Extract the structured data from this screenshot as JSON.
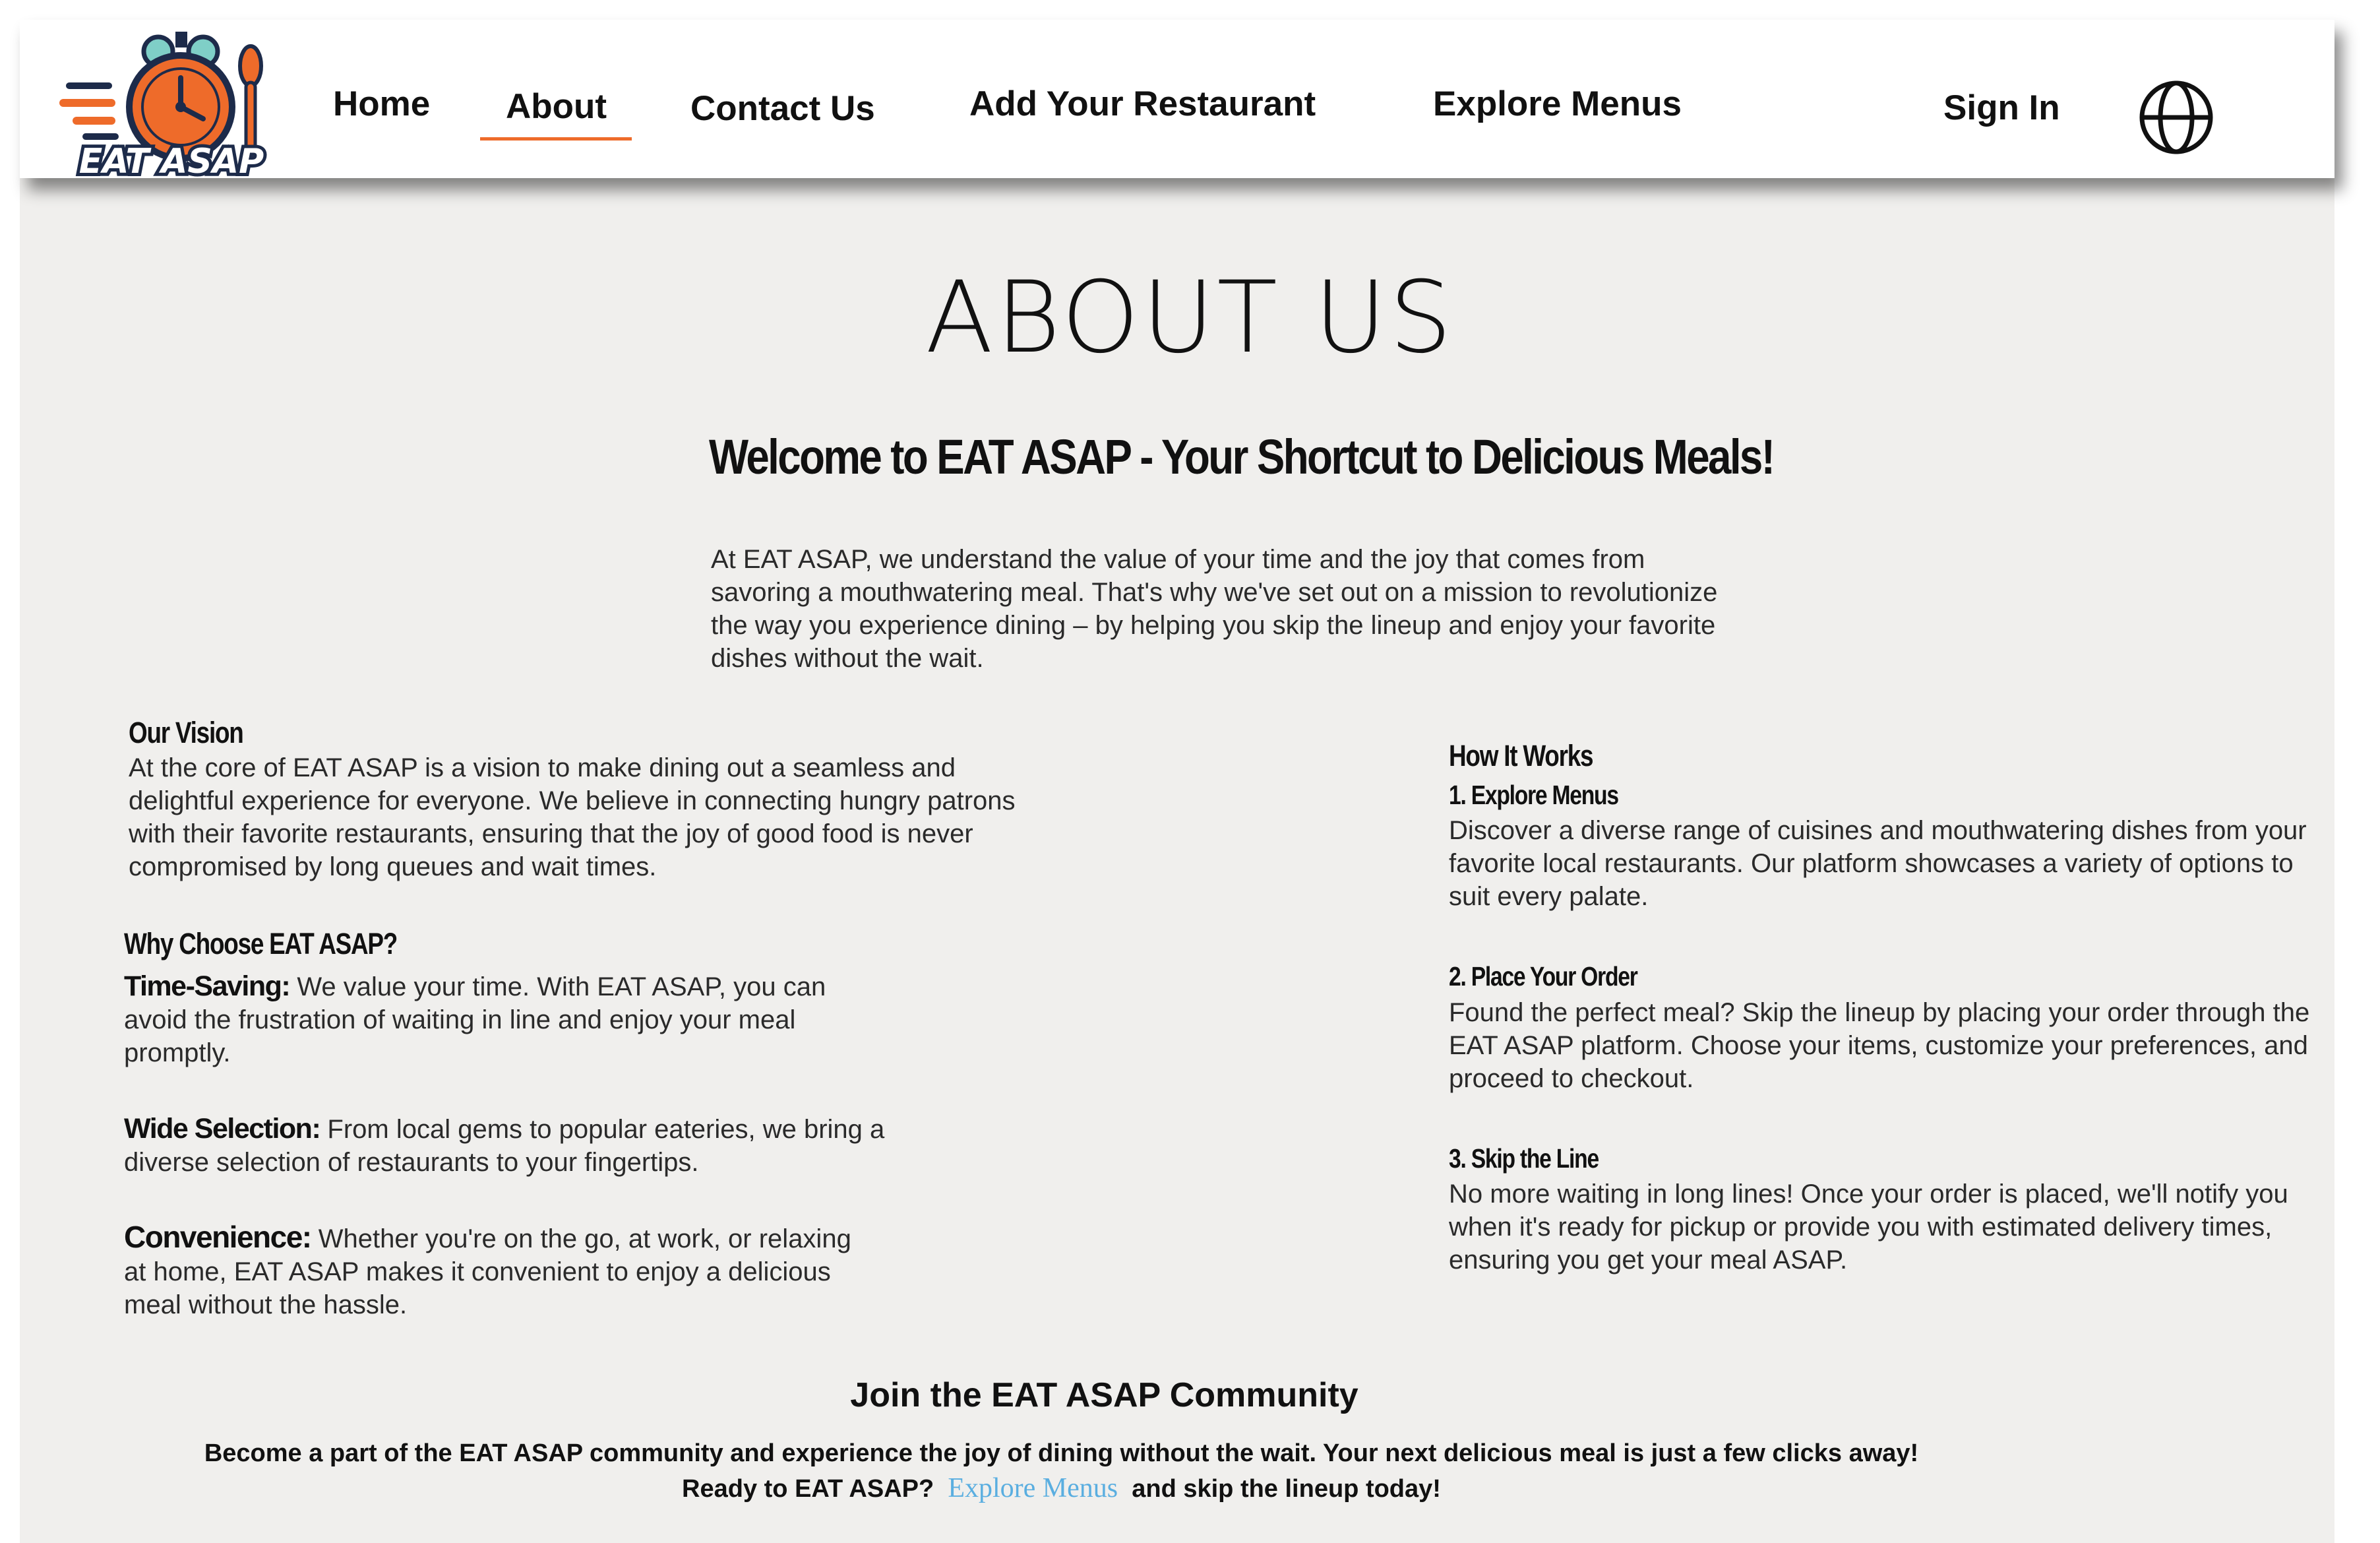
{
  "brand": {
    "logo_text": "EAT ASAP",
    "colors": {
      "orange": "#ee6b2a",
      "navy": "#1d2b4a",
      "teal": "#7fcfc7"
    }
  },
  "nav": {
    "home": "Home",
    "about": "About",
    "contact": "Contact Us",
    "add_restaurant": "Add Your Restaurant",
    "explore": "Explore Menus",
    "sign_in": "Sign In",
    "active_item": "About",
    "active_color": "#ee6b2a",
    "language_icon": "globe-icon"
  },
  "main": {
    "title": "ABOUT US",
    "welcome_heading": "Welcome to EAT ASAP - Your Shortcut to Delicious Meals!",
    "intro_lines": [
      "At EAT ASAP, we understand the value of your time and the joy that comes from",
      "savoring a mouthwatering meal. That's why we've set out on a mission to revolutionize",
      "the way you experience dining – by helping you skip the lineup and enjoy your favorite",
      "dishes without the wait."
    ],
    "vision": {
      "heading": "Our Vision",
      "lines": [
        "At the core of EAT ASAP is a vision to make dining out a seamless and",
        "delightful experience for everyone. We believe in connecting hungry patrons",
        "with their favorite restaurants, ensuring that the joy of good food is never",
        "compromised by long queues and wait times."
      ]
    },
    "why": {
      "heading": "Why Choose EAT ASAP?",
      "time_saving": {
        "term": "Time-Saving:",
        "lines": [
          "We value your time. With EAT ASAP, you can",
          "avoid the frustration of waiting in line and enjoy your meal",
          "promptly."
        ]
      },
      "wide_selection": {
        "term": "Wide Selection:",
        "lines": [
          "From local gems to popular eateries, we bring a",
          "diverse selection of restaurants to your fingertips."
        ]
      },
      "convenience": {
        "term": "Convenience:",
        "lines": [
          "Whether you're on the go, at work, or relaxing",
          "at home, EAT ASAP makes it convenient to enjoy a delicious",
          "meal without the hassle."
        ]
      }
    },
    "how": {
      "heading": "How It Works",
      "step1": {
        "title": "1. Explore Menus",
        "lines": [
          "Discover a diverse range of cuisines and mouthwatering dishes from your",
          "favorite local restaurants. Our platform showcases a variety of options to",
          "suit every palate."
        ]
      },
      "step2": {
        "title": "2. Place Your Order",
        "lines": [
          "Found the perfect meal? Skip the lineup by placing your order through the",
          "EAT ASAP platform. Choose your items, customize your preferences, and",
          "proceed to checkout."
        ]
      },
      "step3": {
        "title": "3. Skip the Line",
        "lines": [
          "No more waiting in long lines! Once your order is placed, we'll notify you",
          "when it's ready for pickup or provide you with estimated delivery times,",
          "ensuring you get your meal ASAP."
        ]
      }
    },
    "join": {
      "heading": "Join the EAT ASAP Community",
      "line1": "Become a part of the EAT ASAP community and experience the joy of dining without the wait. Your next delicious meal is just a few clicks away!",
      "line2_prefix": "Ready to EAT ASAP?",
      "line2_link": "Explore Menus",
      "line2_suffix": "and skip the lineup today!",
      "link_color": "#5aaee0"
    }
  }
}
